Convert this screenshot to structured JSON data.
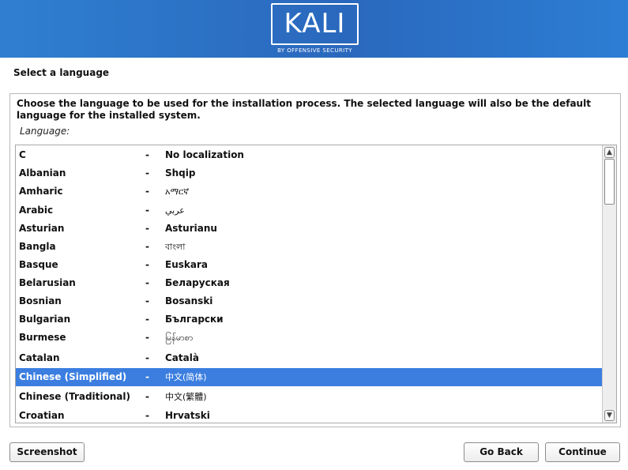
{
  "header": {
    "logo_text": "KALI",
    "logo_subtitle": "BY OFFENSIVE SECURITY",
    "banner_color": "#2a6fc8"
  },
  "page": {
    "title": "Select a language",
    "description": "Choose the language to be used for the installation process. The selected language will also be the default language for the installed system.",
    "field_label": "Language:"
  },
  "languages": [
    {
      "name": "C",
      "native": "No localization"
    },
    {
      "name": "Albanian",
      "native": "Shqip"
    },
    {
      "name": "Amharic",
      "native": "አማርኛ"
    },
    {
      "name": "Arabic",
      "native": "عربي"
    },
    {
      "name": "Asturian",
      "native": "Asturianu"
    },
    {
      "name": "Bangla",
      "native": "বাংলা"
    },
    {
      "name": "Basque",
      "native": "Euskara"
    },
    {
      "name": "Belarusian",
      "native": "Беларуская"
    },
    {
      "name": "Bosnian",
      "native": "Bosanski"
    },
    {
      "name": "Bulgarian",
      "native": "Български"
    },
    {
      "name": "Burmese",
      "native": "မြန်မာစာ"
    },
    {
      "name": "Catalan",
      "native": "Català"
    },
    {
      "name": "Chinese (Simplified)",
      "native": "中文(简体)"
    },
    {
      "name": "Chinese (Traditional)",
      "native": "中文(繁體)"
    },
    {
      "name": "Croatian",
      "native": "Hrvatski"
    }
  ],
  "separator": "-",
  "selected_language": "Chinese (Simplified)",
  "selection_color": "#3b7ee0",
  "scrollbar": {
    "up_icon": "arrow-up-icon",
    "down_icon": "arrow-down-icon"
  },
  "buttons": {
    "screenshot": "Screenshot",
    "back": "Go Back",
    "continue": "Continue"
  }
}
